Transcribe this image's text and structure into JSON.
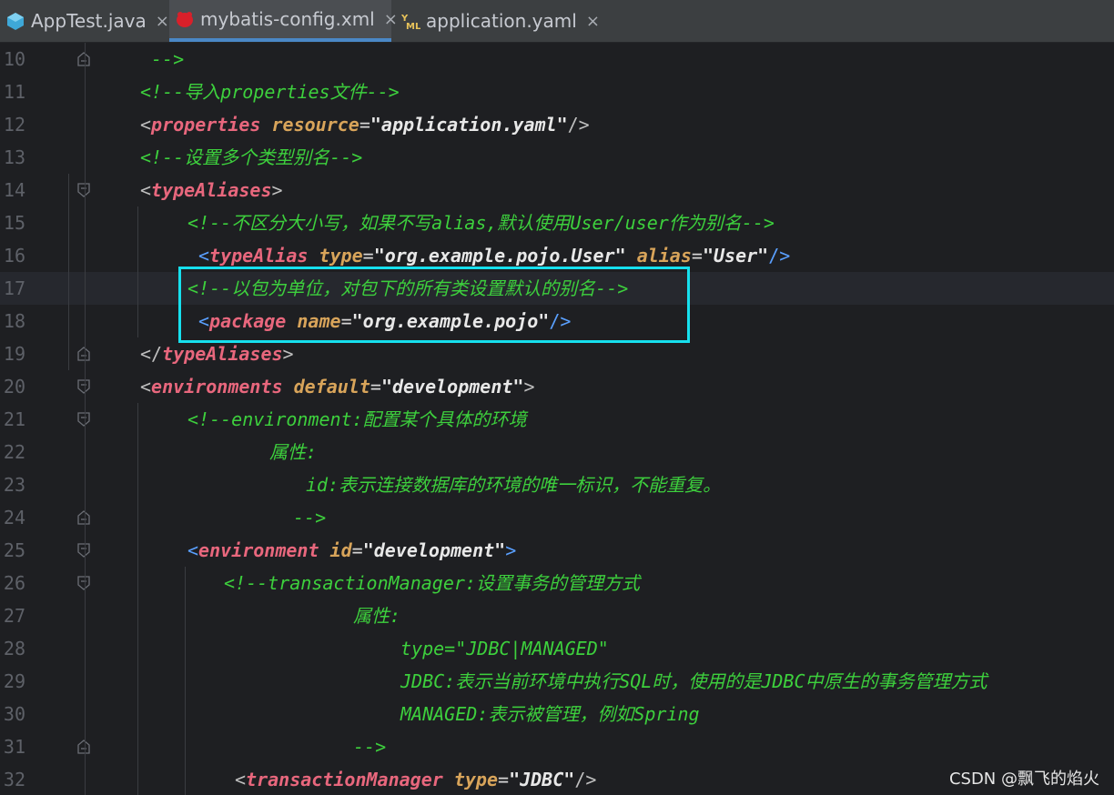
{
  "tabs": [
    {
      "label": "AppTest.java",
      "icon": "java-class-icon",
      "active": false
    },
    {
      "label": "mybatis-config.xml",
      "icon": "mybatis-icon",
      "active": true
    },
    {
      "label": "application.yaml",
      "icon": "yaml-icon",
      "active": false
    }
  ],
  "tab_close_glyph": "×",
  "colors": {
    "comment": "#3dd03d",
    "tag": "#e8677d",
    "attribute": "#d8a45a",
    "value": "#e8e8e8",
    "highlight_box": "#16e0ee",
    "active_tab_underline": "#4a88c7"
  },
  "lines": [
    {
      "num": "10",
      "tokens": [
        {
          "t": "-->",
          "c": "cmt"
        }
      ]
    },
    {
      "num": "11",
      "tokens": [
        {
          "t": "<!--导入properties文件-->",
          "c": "cmt"
        }
      ]
    },
    {
      "num": "12",
      "tokens": [
        {
          "t": "<",
          "c": "br"
        },
        {
          "t": "properties",
          "c": "tag"
        },
        {
          "t": " ",
          "c": "eq"
        },
        {
          "t": "resource",
          "c": "attr"
        },
        {
          "t": "=",
          "c": "eq"
        },
        {
          "t": "\"application.yaml\"",
          "c": "val"
        },
        {
          "t": "/>",
          "c": "br"
        }
      ]
    },
    {
      "num": "13",
      "tokens": [
        {
          "t": "<!--设置多个类型别名-->",
          "c": "cmt"
        }
      ]
    },
    {
      "num": "14",
      "tokens": [
        {
          "t": "<",
          "c": "br"
        },
        {
          "t": "typeAliases",
          "c": "tag"
        },
        {
          "t": ">",
          "c": "br"
        }
      ]
    },
    {
      "num": "15",
      "tokens": [
        {
          "t": "<!--不区分大小写，如果不写alias,默认使用User/user作为别名-->",
          "c": "cmt"
        }
      ]
    },
    {
      "num": "16",
      "tokens": [
        {
          "t": "<",
          "c": "brb"
        },
        {
          "t": "typeAlias",
          "c": "tag"
        },
        {
          "t": " ",
          "c": "eq"
        },
        {
          "t": "type",
          "c": "attr"
        },
        {
          "t": "=",
          "c": "eq"
        },
        {
          "t": "\"org.example.pojo.User\"",
          "c": "val"
        },
        {
          "t": " ",
          "c": "eq"
        },
        {
          "t": "alias",
          "c": "attr"
        },
        {
          "t": "=",
          "c": "eq"
        },
        {
          "t": "\"User\"",
          "c": "val"
        },
        {
          "t": "/>",
          "c": "brb"
        }
      ]
    },
    {
      "num": "17",
      "tokens": [
        {
          "t": "<!--以包为单位，对包下的所有类设置默认的别名-->",
          "c": "cmt"
        }
      ]
    },
    {
      "num": "18",
      "tokens": [
        {
          "t": "<",
          "c": "brb"
        },
        {
          "t": "package",
          "c": "tag"
        },
        {
          "t": " ",
          "c": "eq"
        },
        {
          "t": "name",
          "c": "attr"
        },
        {
          "t": "=",
          "c": "eq"
        },
        {
          "t": "\"org.example.pojo\"",
          "c": "val"
        },
        {
          "t": "/>",
          "c": "brb"
        }
      ]
    },
    {
      "num": "19",
      "tokens": [
        {
          "t": "</",
          "c": "br"
        },
        {
          "t": "typeAliases",
          "c": "tag"
        },
        {
          "t": ">",
          "c": "br"
        }
      ]
    },
    {
      "num": "20",
      "tokens": [
        {
          "t": "<",
          "c": "br"
        },
        {
          "t": "environments",
          "c": "tag"
        },
        {
          "t": " ",
          "c": "eq"
        },
        {
          "t": "default",
          "c": "attr"
        },
        {
          "t": "=",
          "c": "eq"
        },
        {
          "t": "\"development\"",
          "c": "val"
        },
        {
          "t": ">",
          "c": "br"
        }
      ]
    },
    {
      "num": "21",
      "tokens": [
        {
          "t": "<!--environment:配置某个具体的环境",
          "c": "cmt"
        }
      ]
    },
    {
      "num": "22",
      "tokens": [
        {
          "t": "属性:",
          "c": "cmt"
        }
      ]
    },
    {
      "num": "23",
      "tokens": [
        {
          "t": "id:表示连接数据库的环境的唯一标识，不能重复。",
          "c": "cmt"
        }
      ]
    },
    {
      "num": "24",
      "tokens": [
        {
          "t": "-->",
          "c": "cmt"
        }
      ]
    },
    {
      "num": "25",
      "tokens": [
        {
          "t": "<",
          "c": "brb"
        },
        {
          "t": "environment",
          "c": "tag"
        },
        {
          "t": " ",
          "c": "eq"
        },
        {
          "t": "id",
          "c": "attr"
        },
        {
          "t": "=",
          "c": "eq"
        },
        {
          "t": "\"development\"",
          "c": "val"
        },
        {
          "t": ">",
          "c": "brb"
        }
      ]
    },
    {
      "num": "26",
      "tokens": [
        {
          "t": "<!--transactionManager:设置事务的管理方式",
          "c": "cmt"
        }
      ]
    },
    {
      "num": "27",
      "tokens": [
        {
          "t": "属性:",
          "c": "cmt"
        }
      ]
    },
    {
      "num": "28",
      "tokens": [
        {
          "t": "type=\"JDBC|MANAGED\"",
          "c": "cmt"
        }
      ]
    },
    {
      "num": "29",
      "tokens": [
        {
          "t": "JDBC:表示当前环境中执行SQL时，使用的是JDBC中原生的事务管理方式",
          "c": "cmt"
        }
      ]
    },
    {
      "num": "30",
      "tokens": [
        {
          "t": "MANAGED:表示被管理，例如Spring",
          "c": "cmt"
        }
      ]
    },
    {
      "num": "31",
      "tokens": [
        {
          "t": "-->",
          "c": "cmt"
        }
      ]
    },
    {
      "num": "32",
      "tokens": [
        {
          "t": "<",
          "c": "br"
        },
        {
          "t": "transactionManager",
          "c": "tag"
        },
        {
          "t": " ",
          "c": "eq"
        },
        {
          "t": "type",
          "c": "attr"
        },
        {
          "t": "=",
          "c": "eq"
        },
        {
          "t": "\"JDBC\"",
          "c": "val"
        },
        {
          "t": "/>",
          "c": "br"
        }
      ]
    }
  ],
  "current_line": "17",
  "watermark": "CSDN @飘飞的焰火"
}
